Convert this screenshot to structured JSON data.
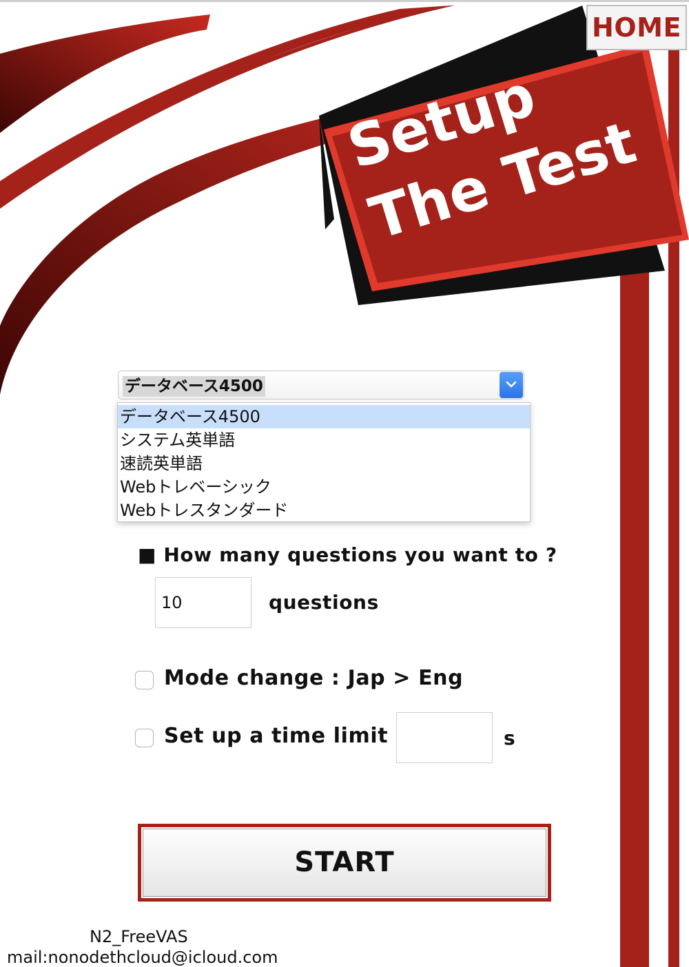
{
  "header": {
    "home_label": "HOME",
    "sign_line1": "Setup",
    "sign_line2": "The Test"
  },
  "theme": {
    "accent": "#a5221b",
    "accent_light": "#e03a2c",
    "sign_shadow": "#111111",
    "select_arrow": "#2f7bea",
    "option_highlight": "#c8dffb"
  },
  "wordbook_select": {
    "value": "データベース4500",
    "options": [
      "データベース4500",
      "システム英単語",
      "速読英単語",
      "Webトレベーシック",
      "Webトレスタンダード"
    ],
    "highlighted_index": 0
  },
  "questions": {
    "prompt": "■ How many questions you want to ?",
    "count_value": "10",
    "unit": "questions"
  },
  "mode_change": {
    "label": "Mode change : Jap > Eng",
    "checked": false
  },
  "time_limit": {
    "label": "Set up a time limit :",
    "value": "",
    "unit": "s",
    "checked": false
  },
  "start_label": "START",
  "footer": {
    "app_name": "N2_FreeVAS",
    "mail": "mail:nonodethcloud@icloud.com"
  }
}
